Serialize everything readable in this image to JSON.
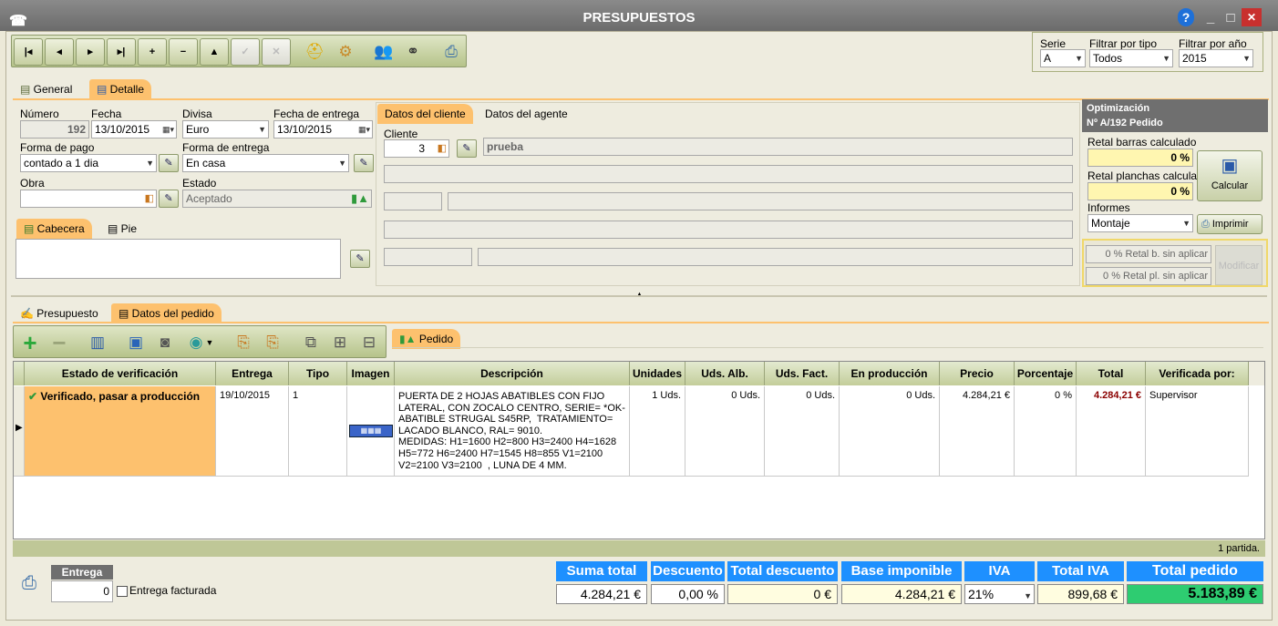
{
  "window": {
    "title": "PRESUPUESTOS",
    "help": "?",
    "minimize": "_",
    "maximize": "□",
    "close": "✕"
  },
  "toolbar": {
    "first": "|◂",
    "prev": "◂",
    "next": "▸",
    "last": "▸|",
    "add": "+",
    "remove": "−",
    "up": "▲",
    "ok": "✓",
    "cancel": "✕"
  },
  "filters": {
    "serie_label": "Serie",
    "serie": "A",
    "tipo_label": "Filtrar por tipo",
    "tipo": "Todos",
    "anio_label": "Filtrar por año",
    "anio": "2015"
  },
  "tabs_top": {
    "general": "General",
    "detalle": "Detalle"
  },
  "detalle": {
    "numero_label": "Número",
    "numero": "192",
    "fecha_label": "Fecha",
    "fecha": "13/10/2015",
    "divisa_label": "Divisa",
    "divisa": "Euro",
    "fecha_entrega_label": "Fecha de entrega",
    "fecha_entrega": "13/10/2015",
    "forma_pago_label": "Forma de pago",
    "forma_pago": "contado a 1 dia",
    "forma_entrega_label": "Forma de entrega",
    "forma_entrega": "En casa",
    "obra_label": "Obra",
    "obra": "",
    "estado_label": "Estado",
    "estado": "Aceptado"
  },
  "subtabs": {
    "cabecera": "Cabecera",
    "pie": "Pie"
  },
  "cliente_tabs": {
    "datos_cliente": "Datos del cliente",
    "datos_agente": "Datos del agente"
  },
  "cliente": {
    "label": "Cliente",
    "codigo": "3",
    "nombre": "prueba"
  },
  "optim": {
    "title": "Optimización",
    "subtitle": "Nº A/192 Pedido",
    "retal_barras_label": "Retal barras calculado",
    "retal_barras": "0 %",
    "retal_planchas_label": "Retal planchas calculado",
    "retal_planchas": "0 %",
    "calcular": "Calcular",
    "informes_label": "Informes",
    "informes": "Montaje",
    "imprimir": "Imprimir",
    "retal_b_sin": "0 % Retal b. sin aplicar",
    "retal_pl_sin": "0 % Retal pl. sin aplicar",
    "modificar": "Modificar"
  },
  "lower_tabs": {
    "presupuesto": "Presupuesto",
    "datos_pedido": "Datos del pedido",
    "pedido": "Pedido"
  },
  "grid": {
    "columns": [
      "Estado de verificación",
      "Entrega",
      "Tipo",
      "Imagen",
      "Descripción",
      "Unidades",
      "Uds. Alb.",
      "Uds. Fact.",
      "En producción",
      "Precio",
      "Porcentaje",
      "Total",
      "Verificada por:"
    ],
    "rows": [
      {
        "estado": "Verificado, pasar a producción",
        "entrega": "19/10/2015",
        "tipo": "1",
        "descripcion": "PUERTA DE 2 HOJAS ABATIBLES CON FIJO LATERAL, CON ZOCALO CENTRO, SERIE= *OK-ABATIBLE STRUGAL S45RP,  TRATAMIENTO= LACADO BLANCO, RAL= 9010.\nMEDIDAS: H1=1600 H2=800 H3=2400 H4=1628 H5=772 H6=2400 H7=1545 H8=855 V1=2100 V2=2100 V3=2100  , LUNA DE 4 MM.",
        "unidades": "1 Uds.",
        "uds_alb": "0 Uds.",
        "uds_fact": "0 Uds.",
        "en_produccion": "0 Uds.",
        "precio": "4.284,21 €",
        "porcentaje": "0 %",
        "total": "4.284,21 €",
        "verificada_por": "Supervisor"
      }
    ],
    "footer": "1 partida."
  },
  "entrega": {
    "label": "Entrega",
    "value": "0",
    "facturada": "Entrega facturada"
  },
  "totals": {
    "suma_total_label": "Suma total",
    "suma_total": "4.284,21 €",
    "descuento_label": "Descuento",
    "descuento": "0,00 %",
    "total_descuento_label": "Total descuento",
    "total_descuento": "0 €",
    "base_label": "Base imponible",
    "base": "4.284,21 €",
    "iva_label": "IVA",
    "iva": "21%",
    "total_iva_label": "Total IVA",
    "total_iva": "899,68 €",
    "total_pedido_label": "Total pedido",
    "total_pedido": "5.183,89 €"
  },
  "colors": {
    "accent": "#1e90ff",
    "tab_active": "#fdc16e",
    "total_green": "#2ecc71",
    "highlight_yellow": "#fff6b0"
  }
}
